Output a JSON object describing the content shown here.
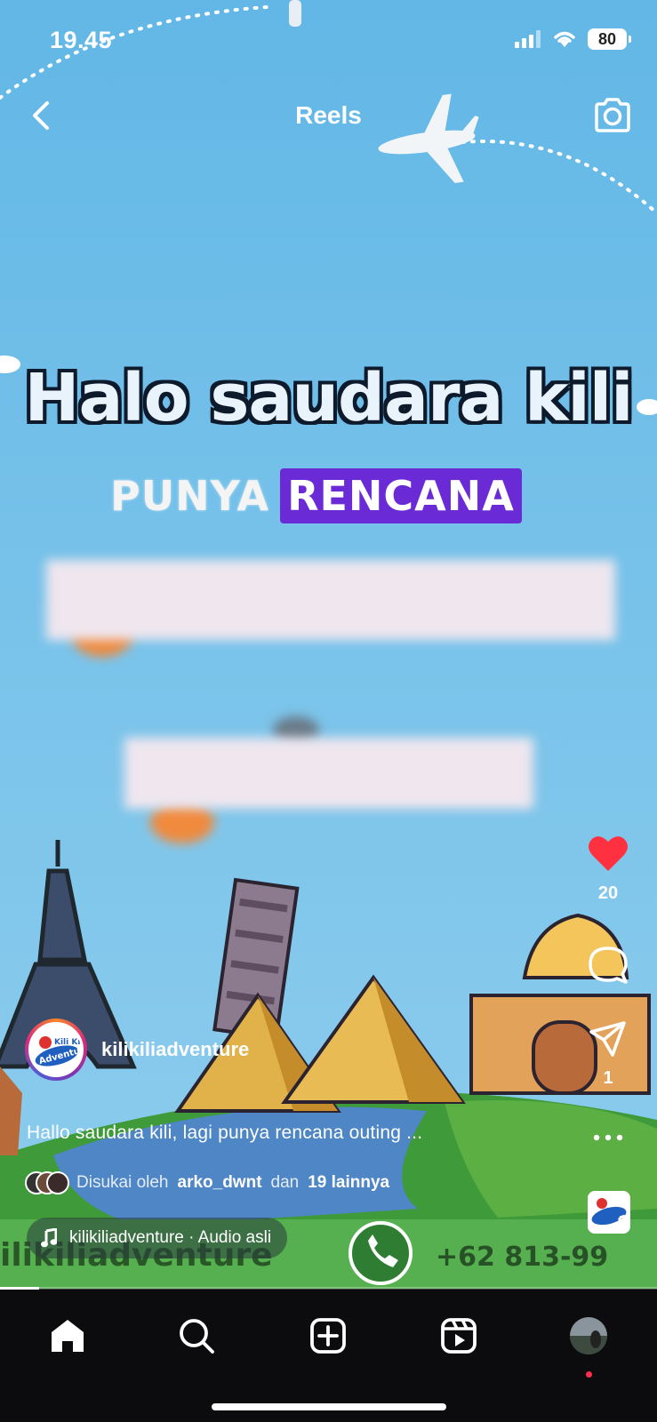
{
  "status_bar": {
    "time": "19.45",
    "battery": "80"
  },
  "header": {
    "title": "Reels"
  },
  "video_overlay": {
    "headline": "Halo saudara kili",
    "subtitle_plain": "PUNYA",
    "subtitle_highlight": "RENCANA",
    "banner_name": "kilikiliadventure",
    "banner_phone": "+62 813-99"
  },
  "post": {
    "username": "kilikiliadventure",
    "caption": "Hallo saudara kili, lagi punya rencana outing ...",
    "liked_by_prefix": "Disukai oleh",
    "liked_by_user": "arko_dwnt",
    "liked_by_joiner": "dan",
    "liked_by_others": "19 lainnya",
    "audio": "kilikiliadventure · Audio asli",
    "avatar_text_1": "Kili Kili",
    "avatar_text_2": "Adventure"
  },
  "actions": {
    "like_count": "20",
    "share_count": "1"
  },
  "nav": {
    "items": [
      "home",
      "search",
      "create",
      "reels",
      "profile"
    ]
  },
  "colors": {
    "sky": "#74c0ea",
    "like_red": "#ff3040",
    "highlight_purple": "#6a2ad6",
    "nav_bg": "#0c0c0f"
  },
  "icons": {
    "back": "chevron-left-icon",
    "camera": "camera-icon",
    "like": "heart-icon",
    "comment": "comment-icon",
    "share": "send-icon",
    "more": "more-icon",
    "music": "music-note-icon"
  },
  "progress_fraction": 0.06
}
